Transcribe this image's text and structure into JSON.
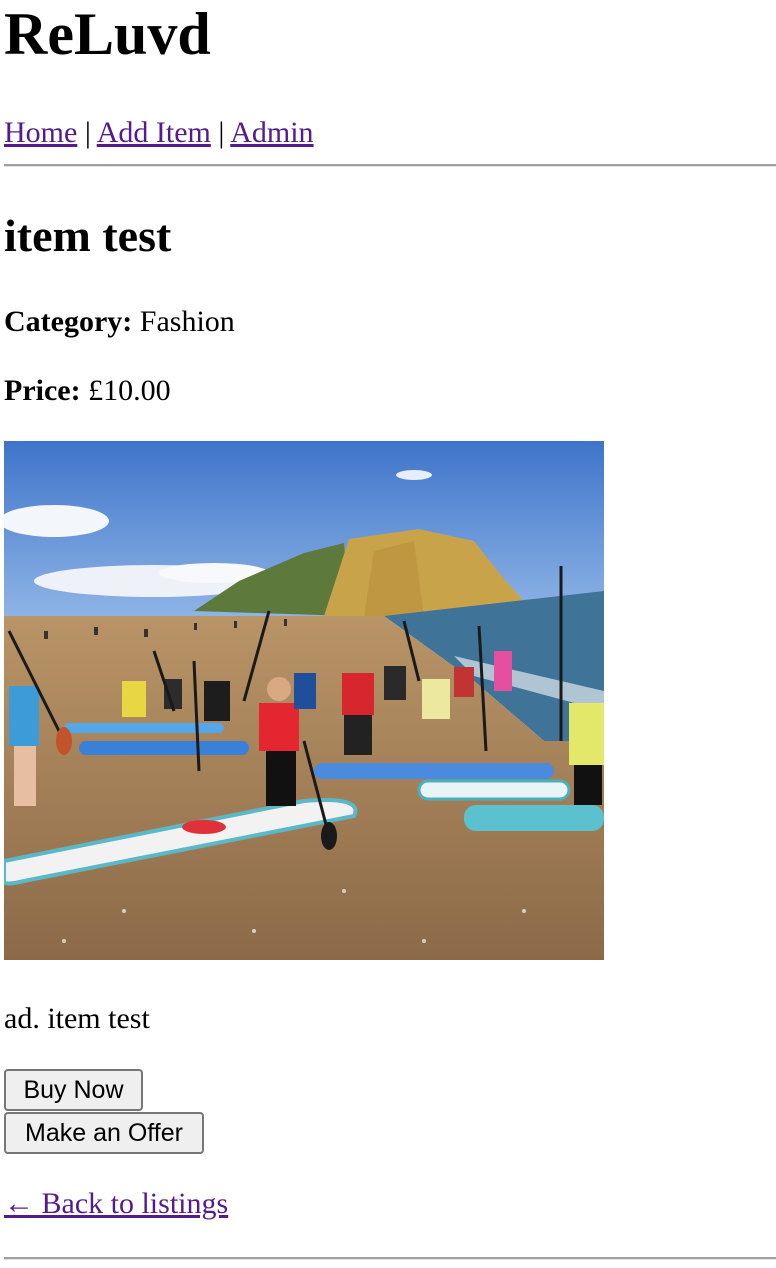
{
  "site": {
    "title": "ReLuvd"
  },
  "nav": {
    "home": "Home",
    "add_item": "Add Item",
    "admin": "Admin",
    "separator": "|"
  },
  "item": {
    "title": "item test",
    "category_label": "Category:",
    "category_value": "Fashion",
    "price_label": "Price:",
    "price_value": "£10.00",
    "description": "ad. item test"
  },
  "actions": {
    "buy_now": "Buy Now",
    "make_offer": "Make an Offer"
  },
  "back_link": "← Back to listings",
  "photo": {
    "alt": "Group of paddleboarders on a beach with a sandstone cliff",
    "colors": {
      "sky": "#4a7fd0",
      "cliff": "#c9a34a",
      "sea": "#3f7398",
      "sand": "#a9835a"
    }
  }
}
